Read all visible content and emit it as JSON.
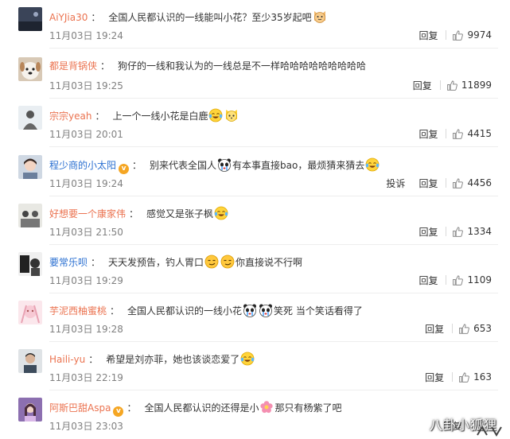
{
  "labels": {
    "reply": "回复",
    "report": "投诉"
  },
  "colors": {
    "username": "#eb7350",
    "username_alt": "#2a6fd1",
    "vip_badge": "#f5a623",
    "time": "#808080"
  },
  "comments": [
    {
      "username": "AiYJia30",
      "avatar": "dark-landscape-avatar",
      "time": "11月03日 19:24",
      "likes": "9974",
      "segments": [
        {
          "text": "全国人民都认识的一线能叫小花？至少35岁起吧"
        },
        {
          "emoji": "cat-face-emoji"
        }
      ]
    },
    {
      "username": "都是背锅侠",
      "avatar": "white-dog-avatar",
      "time": "11月03日 19:25",
      "likes": "11899",
      "segments": [
        {
          "text": "狗仔的一线和我认为的一线总是不一样哈哈哈哈哈哈哈哈哈"
        }
      ]
    },
    {
      "username": "宗宗yeah",
      "avatar": "person-silhouette-avatar",
      "time": "11月03日 20:01",
      "likes": "4415",
      "segments": [
        {
          "text": "上一个一线小花是白鹿"
        },
        {
          "emoji": "laughing-tears-emoji"
        },
        {
          "emoji": "yellow-face-emoji"
        }
      ]
    },
    {
      "username": "程少商的小太阳",
      "vip": true,
      "avatar": "girl-portrait-avatar",
      "time": "11月03日 19:24",
      "likes": "4456",
      "show_report": true,
      "segments": [
        {
          "text": "别来代表全国人"
        },
        {
          "emoji": "panda-crying-emoji"
        },
        {
          "text": "有本事直接bao，最烦猜来猜去"
        },
        {
          "emoji": "laughing-tears-emoji"
        }
      ]
    },
    {
      "username": "好想要一个康家伟",
      "avatar": "group-photo-avatar",
      "time": "11月03日 21:50",
      "likes": "1334",
      "segments": [
        {
          "text": "感觉又是张子枫"
        },
        {
          "emoji": "laughing-tears-emoji"
        }
      ]
    },
    {
      "username": "要常乐呗",
      "avatar": "black-white-avatar",
      "time": "11月03日 19:29",
      "likes": "1109",
      "segments": [
        {
          "text": "天天发预告，钓人胃口"
        },
        {
          "emoji": "smirk-face-emoji"
        },
        {
          "emoji": "smirk-face-emoji"
        },
        {
          "text": "你直接说不行啊"
        }
      ]
    },
    {
      "username": "芋泥西柚蜜桃",
      "avatar": "pink-cartoon-avatar",
      "time": "11月03日 19:28",
      "likes": "653",
      "segments": [
        {
          "text": "全国人民都认识的一线小花"
        },
        {
          "emoji": "panda-crying-emoji"
        },
        {
          "emoji": "panda-crying-emoji"
        },
        {
          "text": "笑死 当个笑话看得了"
        }
      ]
    },
    {
      "username": "Haili-yu",
      "avatar": "man-portrait-avatar",
      "time": "11月03日 22:19",
      "likes": "163",
      "segments": [
        {
          "text": "希望是刘亦菲，她也该谈恋爱了"
        },
        {
          "emoji": "laughing-tears-emoji"
        }
      ]
    },
    {
      "username": "阿斯巴甜Aspa",
      "vip": true,
      "avatar": "purple-portrait-avatar",
      "time": "11月03日 23:03",
      "likes": "",
      "segments": [
        {
          "text": "全国人民都认识的还得是小"
        },
        {
          "emoji": "pink-flower-emoji"
        },
        {
          "text": "那只有杨紫了吧"
        }
      ]
    }
  ],
  "watermark": {
    "text": "八卦小狐狸",
    "logo": "watermark-logo"
  }
}
